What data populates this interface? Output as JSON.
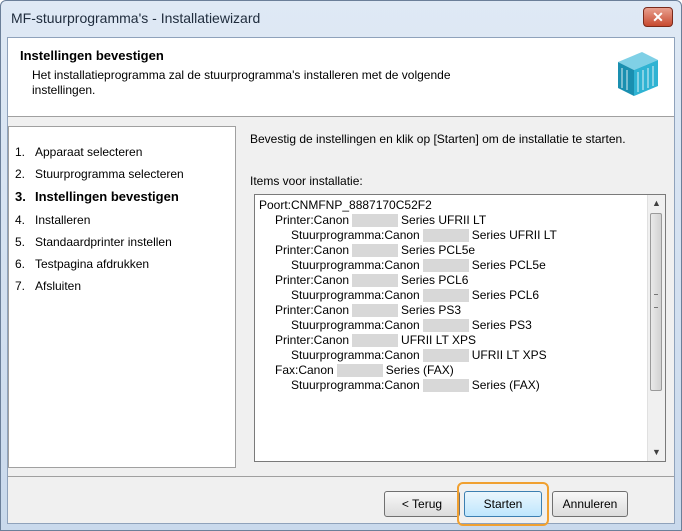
{
  "window": {
    "title": "MF-stuurprogramma's - Installatiewizard",
    "close_symbol": "✕"
  },
  "header": {
    "title": "Instellingen bevestigen",
    "description": "Het installatieprogramma zal de stuurprogramma's installeren met de volgende instellingen."
  },
  "steps": [
    {
      "num": "1.",
      "label": "Apparaat selecteren"
    },
    {
      "num": "2.",
      "label": "Stuurprogramma selecteren"
    },
    {
      "num": "3.",
      "label": "Instellingen bevestigen"
    },
    {
      "num": "4.",
      "label": "Installeren"
    },
    {
      "num": "5.",
      "label": "Standaardprinter instellen"
    },
    {
      "num": "6.",
      "label": "Testpagina afdrukken"
    },
    {
      "num": "7.",
      "label": "Afsluiten"
    }
  ],
  "content": {
    "instruction": "Bevestig de instellingen en klik op [Starten] om de installatie te starten.",
    "items_label": "Items voor installatie:",
    "items": [
      {
        "pre": "Poort:CNMFNP_8887170C52F2",
        "post": ""
      },
      {
        "pre": "Printer:Canon",
        "post": "Series UFRII LT"
      },
      {
        "pre": "Stuurprogramma:Canon",
        "post": "Series UFRII LT"
      },
      {
        "pre": "Printer:Canon",
        "post": "Series PCL5e"
      },
      {
        "pre": "Stuurprogramma:Canon",
        "post": "Series PCL5e"
      },
      {
        "pre": "Printer:Canon",
        "post": "Series PCL6"
      },
      {
        "pre": "Stuurprogramma:Canon",
        "post": "Series PCL6"
      },
      {
        "pre": "Printer:Canon",
        "post": "Series PS3"
      },
      {
        "pre": "Stuurprogramma:Canon",
        "post": "Series PS3"
      },
      {
        "pre": "Printer:Canon",
        "post": "UFRII LT XPS"
      },
      {
        "pre": "Stuurprogramma:Canon",
        "post": "UFRII LT XPS"
      },
      {
        "pre": "Fax:Canon",
        "post": "Series (FAX)"
      },
      {
        "pre": "Stuurprogramma:Canon",
        "post": "Series (FAX)"
      }
    ]
  },
  "buttons": {
    "back": "< Terug",
    "start": "Starten",
    "cancel": "Annuleren"
  },
  "colors": {
    "highlight": "#f0a030",
    "close": "#c74a30"
  }
}
